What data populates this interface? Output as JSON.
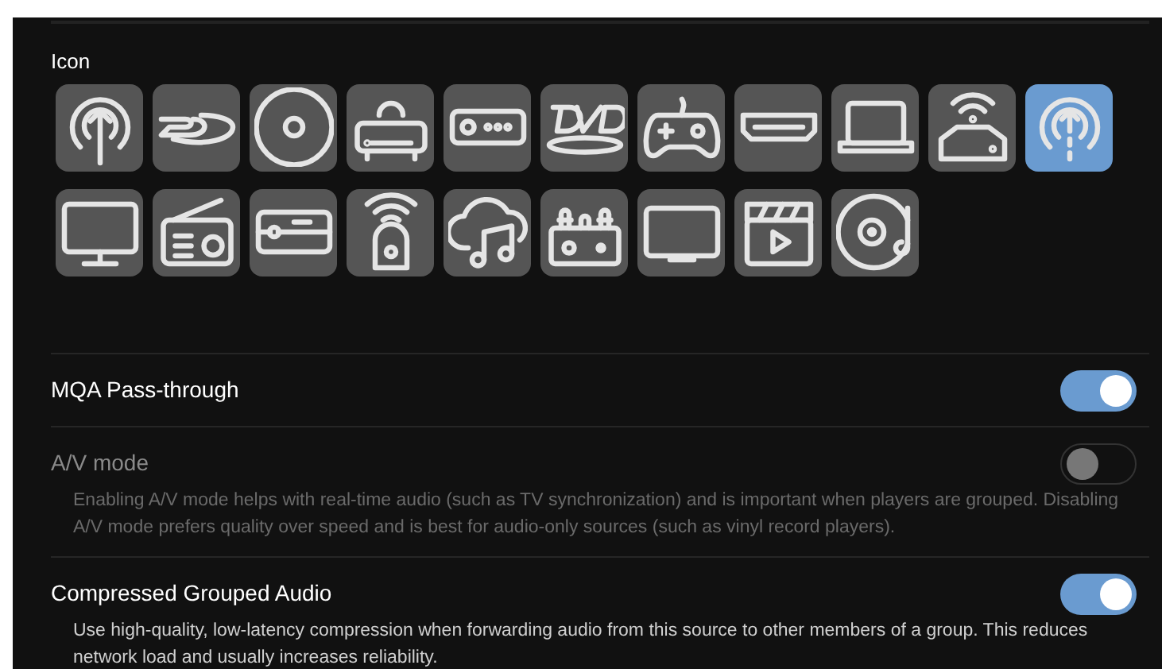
{
  "icon_picker": {
    "label": "Icon",
    "icons": [
      {
        "selected": false
      },
      {
        "selected": false
      },
      {
        "selected": false
      },
      {
        "selected": false
      },
      {
        "selected": false
      },
      {
        "selected": false
      },
      {
        "selected": false
      },
      {
        "selected": false
      },
      {
        "selected": false
      },
      {
        "selected": false
      },
      {
        "selected": true
      },
      {
        "selected": false
      },
      {
        "selected": false
      },
      {
        "selected": false
      },
      {
        "selected": false
      },
      {
        "selected": false
      },
      {
        "selected": false
      },
      {
        "selected": false
      },
      {
        "selected": false
      },
      {
        "selected": false
      }
    ]
  },
  "settings": [
    {
      "title": "MQA Pass-through",
      "on": true,
      "disabled": false
    },
    {
      "title": "A/V mode",
      "description": "Enabling A/V mode helps with real-time audio (such as TV synchronization) and is important when players are grouped. Disabling A/V mode prefers quality over speed and is best for audio-only sources (such as vinyl record players).",
      "on": false,
      "disabled": true
    },
    {
      "title": "Compressed Grouped Audio",
      "description": "Use high-quality, low-latency compression when forwarding audio from this source to other members of a group. This reduces network load and usually increases reliability.",
      "on": true,
      "disabled": false
    }
  ]
}
